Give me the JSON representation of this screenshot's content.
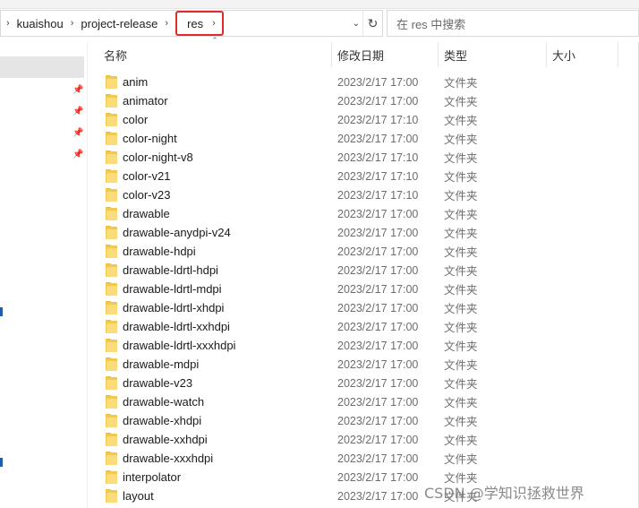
{
  "address": {
    "crumbs": [
      "kuaishou",
      "project-release"
    ],
    "active_crumb": "res",
    "refresh_icon": "refresh-icon",
    "dropdown_icon": "chevron-down-icon"
  },
  "search": {
    "placeholder": "在 res 中搜索"
  },
  "columns": {
    "name": "名称",
    "date": "修改日期",
    "type": "类型",
    "size": "大小"
  },
  "files": [
    {
      "name": "anim",
      "date": "2023/2/17 17:00",
      "type": "文件夹"
    },
    {
      "name": "animator",
      "date": "2023/2/17 17:00",
      "type": "文件夹"
    },
    {
      "name": "color",
      "date": "2023/2/17 17:10",
      "type": "文件夹"
    },
    {
      "name": "color-night",
      "date": "2023/2/17 17:00",
      "type": "文件夹"
    },
    {
      "name": "color-night-v8",
      "date": "2023/2/17 17:10",
      "type": "文件夹"
    },
    {
      "name": "color-v21",
      "date": "2023/2/17 17:10",
      "type": "文件夹"
    },
    {
      "name": "color-v23",
      "date": "2023/2/17 17:10",
      "type": "文件夹"
    },
    {
      "name": "drawable",
      "date": "2023/2/17 17:00",
      "type": "文件夹"
    },
    {
      "name": "drawable-anydpi-v24",
      "date": "2023/2/17 17:00",
      "type": "文件夹"
    },
    {
      "name": "drawable-hdpi",
      "date": "2023/2/17 17:00",
      "type": "文件夹"
    },
    {
      "name": "drawable-ldrtl-hdpi",
      "date": "2023/2/17 17:00",
      "type": "文件夹"
    },
    {
      "name": "drawable-ldrtl-mdpi",
      "date": "2023/2/17 17:00",
      "type": "文件夹"
    },
    {
      "name": "drawable-ldrtl-xhdpi",
      "date": "2023/2/17 17:00",
      "type": "文件夹"
    },
    {
      "name": "drawable-ldrtl-xxhdpi",
      "date": "2023/2/17 17:00",
      "type": "文件夹"
    },
    {
      "name": "drawable-ldrtl-xxxhdpi",
      "date": "2023/2/17 17:00",
      "type": "文件夹"
    },
    {
      "name": "drawable-mdpi",
      "date": "2023/2/17 17:00",
      "type": "文件夹"
    },
    {
      "name": "drawable-v23",
      "date": "2023/2/17 17:00",
      "type": "文件夹"
    },
    {
      "name": "drawable-watch",
      "date": "2023/2/17 17:00",
      "type": "文件夹"
    },
    {
      "name": "drawable-xhdpi",
      "date": "2023/2/17 17:00",
      "type": "文件夹"
    },
    {
      "name": "drawable-xxhdpi",
      "date": "2023/2/17 17:00",
      "type": "文件夹"
    },
    {
      "name": "drawable-xxxhdpi",
      "date": "2023/2/17 17:00",
      "type": "文件夹"
    },
    {
      "name": "interpolator",
      "date": "2023/2/17 17:00",
      "type": "文件夹"
    },
    {
      "name": "layout",
      "date": "2023/2/17 17:00",
      "type": "文件夹"
    }
  ],
  "watermark": "CSDN @学知识拯救世界",
  "colors": {
    "highlight_border": "#e12a2a",
    "folder": "#f2c94c",
    "nav_selected": "#e5e5e5"
  }
}
